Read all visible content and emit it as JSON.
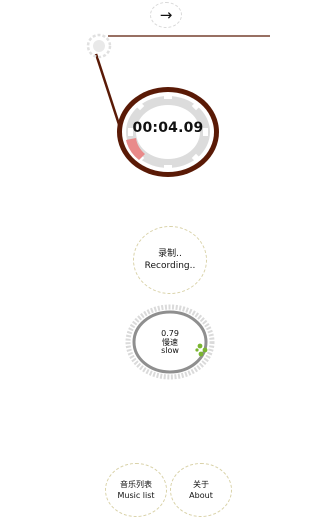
{
  "header": {
    "next_arrow": "→"
  },
  "timer": {
    "elapsed": "00:04.09",
    "progress": 0.04
  },
  "record": {
    "label_cn": "录制..",
    "label_en": "Recording.."
  },
  "speed": {
    "value": "0.79",
    "label_cn": "慢速",
    "label_en": "slow",
    "knob_color": "#7ab530"
  },
  "bottom_nav": {
    "music_cn": "音乐列表",
    "music_en": "Music list",
    "about_cn": "关于",
    "about_en": "About"
  },
  "colors": {
    "disc_rim": "#5a1a06",
    "disc_inner": "#d9d9d9",
    "accent_red": "#e98a8a",
    "button_border": "#d9d2a8"
  }
}
